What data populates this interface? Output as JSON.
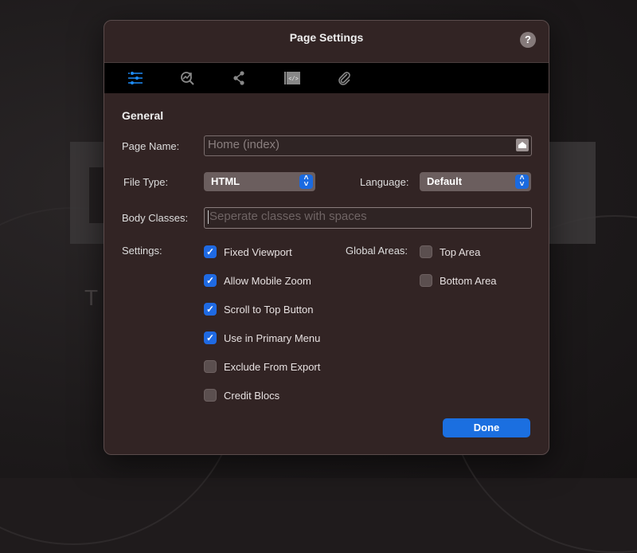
{
  "background": {
    "headline_fragment": "D",
    "subheadline_fragment": "T"
  },
  "dialog": {
    "title": "Page Settings",
    "help_label": "?",
    "toolbar": {
      "tabs": [
        {
          "name": "general",
          "icon": "sliders-icon",
          "active": true
        },
        {
          "name": "seo",
          "icon": "seo-analytics-icon",
          "active": false
        },
        {
          "name": "share",
          "icon": "share-icon",
          "active": false
        },
        {
          "name": "code",
          "icon": "code-icon",
          "active": false
        },
        {
          "name": "attachments",
          "icon": "paperclip-icon",
          "active": false
        }
      ]
    },
    "section_title": "General",
    "page_name": {
      "label": "Page Name:",
      "placeholder": "Home (index)",
      "value": ""
    },
    "file_type": {
      "label": "File Type:",
      "selected": "HTML"
    },
    "language": {
      "label": "Language:",
      "selected": "Default"
    },
    "body_classes": {
      "label": "Body Classes:",
      "placeholder": "Seperate classes with spaces",
      "value": ""
    },
    "settings": {
      "label": "Settings:",
      "items": [
        {
          "label": "Fixed Viewport",
          "checked": true
        },
        {
          "label": "Allow Mobile Zoom",
          "checked": true
        },
        {
          "label": "Scroll to Top Button",
          "checked": true
        },
        {
          "label": "Use in Primary Menu",
          "checked": true
        },
        {
          "label": "Exclude From Export",
          "checked": false
        },
        {
          "label": "Credit Blocs",
          "checked": false
        }
      ]
    },
    "global_areas": {
      "label": "Global Areas:",
      "items": [
        {
          "label": "Top Area",
          "checked": false
        },
        {
          "label": "Bottom Area",
          "checked": false
        }
      ]
    },
    "done_label": "Done",
    "colors": {
      "accent": "#1f6ae3",
      "dialog_bg": "#322424",
      "toolbar_bg": "#000000"
    }
  }
}
